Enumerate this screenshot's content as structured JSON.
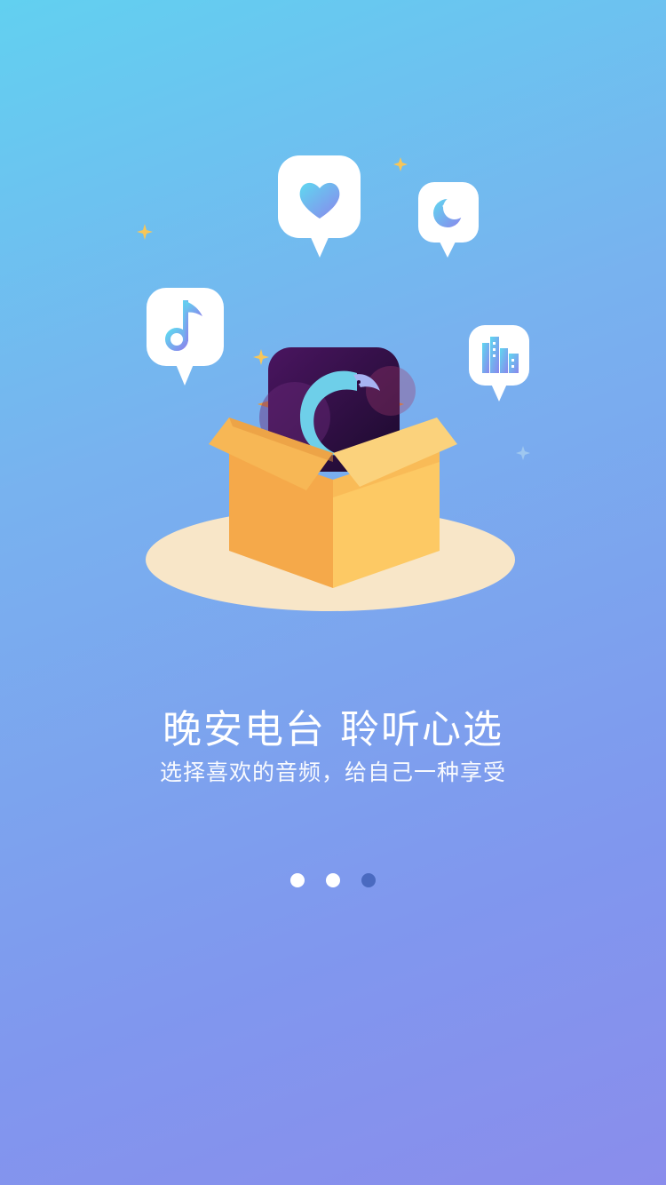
{
  "onboarding": {
    "title": "晚安电台 聆听心选",
    "subtitle": "选择喜欢的音频，给自己一种享受",
    "page_indicator": {
      "total": 3,
      "current": 3
    }
  },
  "illustration": {
    "bubbles": [
      "music-note-icon",
      "heart-icon",
      "moon-icon",
      "city-icon"
    ],
    "center": "app-logo-in-box"
  },
  "colors": {
    "accent_dot": "#4a6ac0",
    "box_orange": "#f5a94a",
    "box_light": "#fdc964",
    "plate": "#f8e6c8"
  }
}
